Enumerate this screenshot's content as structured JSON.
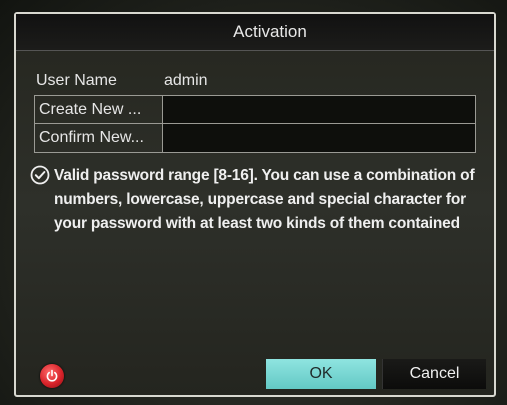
{
  "dialog": {
    "title": "Activation",
    "user_name_label": "User Name",
    "user_name_value": "admin",
    "create_new_label": "Create New ...",
    "create_new_value": "",
    "confirm_new_label": "Confirm New...",
    "confirm_new_value": "",
    "hint_icon": "check-circle-icon",
    "hint_text": "Valid password range [8-16]. You can use a combination of numbers, lowercase, uppercase and special character for your password with at least two kinds of them contained",
    "ok_label": "OK",
    "cancel_label": "Cancel",
    "power_icon": "power-icon"
  },
  "colors": {
    "ok_button": "#7dd8d4",
    "power_button": "#d8232a",
    "dialog_border": "#d8d8d0"
  }
}
